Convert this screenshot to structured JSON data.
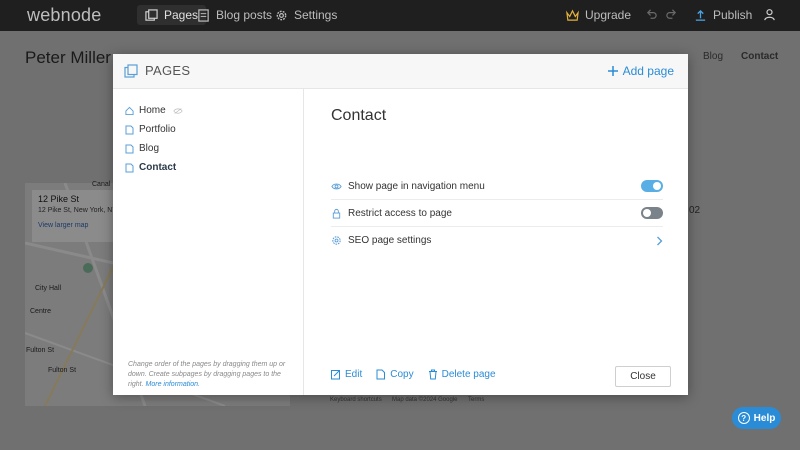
{
  "topbar": {
    "logo": "webnode",
    "nav": [
      {
        "label": "Pages",
        "icon": "pages-icon"
      },
      {
        "label": "Blog posts",
        "icon": "document-icon"
      },
      {
        "label": "Settings",
        "icon": "gear-icon"
      }
    ],
    "upgrade_label": "Upgrade",
    "publish_label": "Publish"
  },
  "background_page": {
    "site_title": "Peter Miller",
    "nav": [
      "Blog",
      "Contact"
    ],
    "map_card": {
      "title": "12 Pike St",
      "address": "12 Pike St, New York, NY",
      "link": "View larger map"
    },
    "map_labels": [
      "City Hall",
      "Centre",
      "Fulton St",
      "Fulton St",
      "Canal"
    ],
    "map_footer": [
      "Keyboard shortcuts",
      "Map data ©2024 Google",
      "Terms"
    ],
    "digits": "02"
  },
  "modal": {
    "title": "PAGES",
    "add_page_label": "Add page",
    "pages": [
      {
        "label": "Home",
        "hidden_icon": true
      },
      {
        "label": "Portfolio"
      },
      {
        "label": "Blog"
      },
      {
        "label": "Contact",
        "active": true
      }
    ],
    "hint_text": "Change order of the pages by dragging them up or down. Create subpages by dragging pages to the right.",
    "hint_link": "More information.",
    "content_title": "Contact",
    "settings": [
      {
        "label": "Show page in navigation menu",
        "control": "toggle",
        "state": "on"
      },
      {
        "label": "Restrict access to page",
        "control": "toggle",
        "state": "off"
      },
      {
        "label": "SEO page settings",
        "control": "chevron"
      }
    ],
    "actions": {
      "edit": "Edit",
      "copy": "Copy",
      "delete": "Delete page"
    },
    "close_label": "Close"
  },
  "help_label": "Help",
  "colors": {
    "accent": "#2a8cd6",
    "toggle_on": "#5aaee6",
    "toggle_off": "#7a828a",
    "topbar": "#1f1f1f",
    "upgrade": "#e2b13c"
  }
}
